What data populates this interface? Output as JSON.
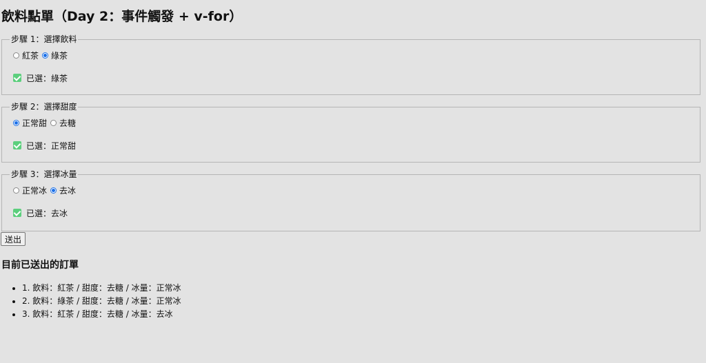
{
  "title": "飲料點單（Day 2：事件觸發 + v-for）",
  "steps": [
    {
      "legend": "步驟 1：選擇飲料",
      "options": [
        {
          "label": "紅茶",
          "checked": false
        },
        {
          "label": "綠茶",
          "checked": true
        }
      ],
      "selected_text": "已選：綠茶"
    },
    {
      "legend": "步驟 2：選擇甜度",
      "options": [
        {
          "label": "正常甜",
          "checked": true
        },
        {
          "label": "去糖",
          "checked": false
        }
      ],
      "selected_text": "已選：正常甜"
    },
    {
      "legend": "步驟 3：選擇冰量",
      "options": [
        {
          "label": "正常冰",
          "checked": false
        },
        {
          "label": "去冰",
          "checked": true
        }
      ],
      "selected_text": "已選：去冰"
    }
  ],
  "submit_label": "送出",
  "orders_heading": "目前已送出的訂單",
  "orders": [
    "1. 飲料：紅茶 / 甜度：去糖 / 冰量：正常冰",
    "2. 飲料：綠茶 / 甜度：去糖 / 冰量：正常冰",
    "3. 飲料：紅茶 / 甜度：去糖 / 冰量：去冰"
  ],
  "colors": {
    "background": "#e3e3e3",
    "radio_accent": "#1a6fe8",
    "check_green": "#5ccf7d"
  },
  "icons": {
    "selected": "check-box-icon"
  }
}
